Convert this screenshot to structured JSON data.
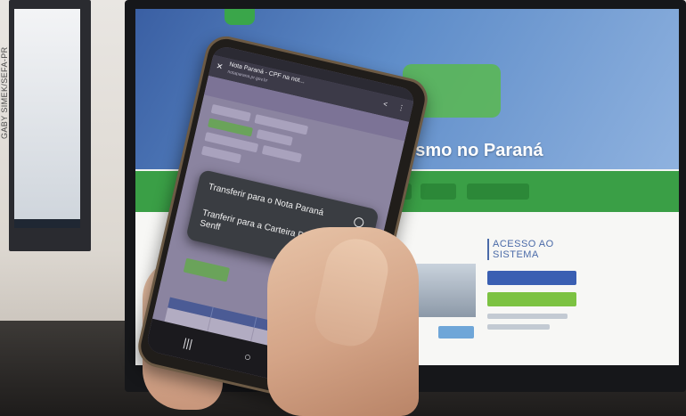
{
  "photo": {
    "credit": "GABY SIMEK/SEFA-PR"
  },
  "monitor_site": {
    "headline": "turismo no Paraná",
    "access_title": "ACESSO AO SISTEMA",
    "colors": {
      "header_blue": "#4b78b8",
      "menu_green": "#3a9f46",
      "access_btn_blue": "#3a5fb2",
      "access_btn_green": "#7cc242"
    }
  },
  "phone_screen": {
    "browser": {
      "title": "Nota Paraná - CPF na not...",
      "url": "notaparana.pr.gov.br"
    },
    "popup": {
      "options": [
        {
          "label": "Transferir para o Nota Paraná"
        },
        {
          "label": "Tranferir para a Carteira Digital Senff"
        }
      ]
    },
    "nav_icons": [
      "recent-apps-icon",
      "home-icon",
      "back-icon"
    ]
  }
}
